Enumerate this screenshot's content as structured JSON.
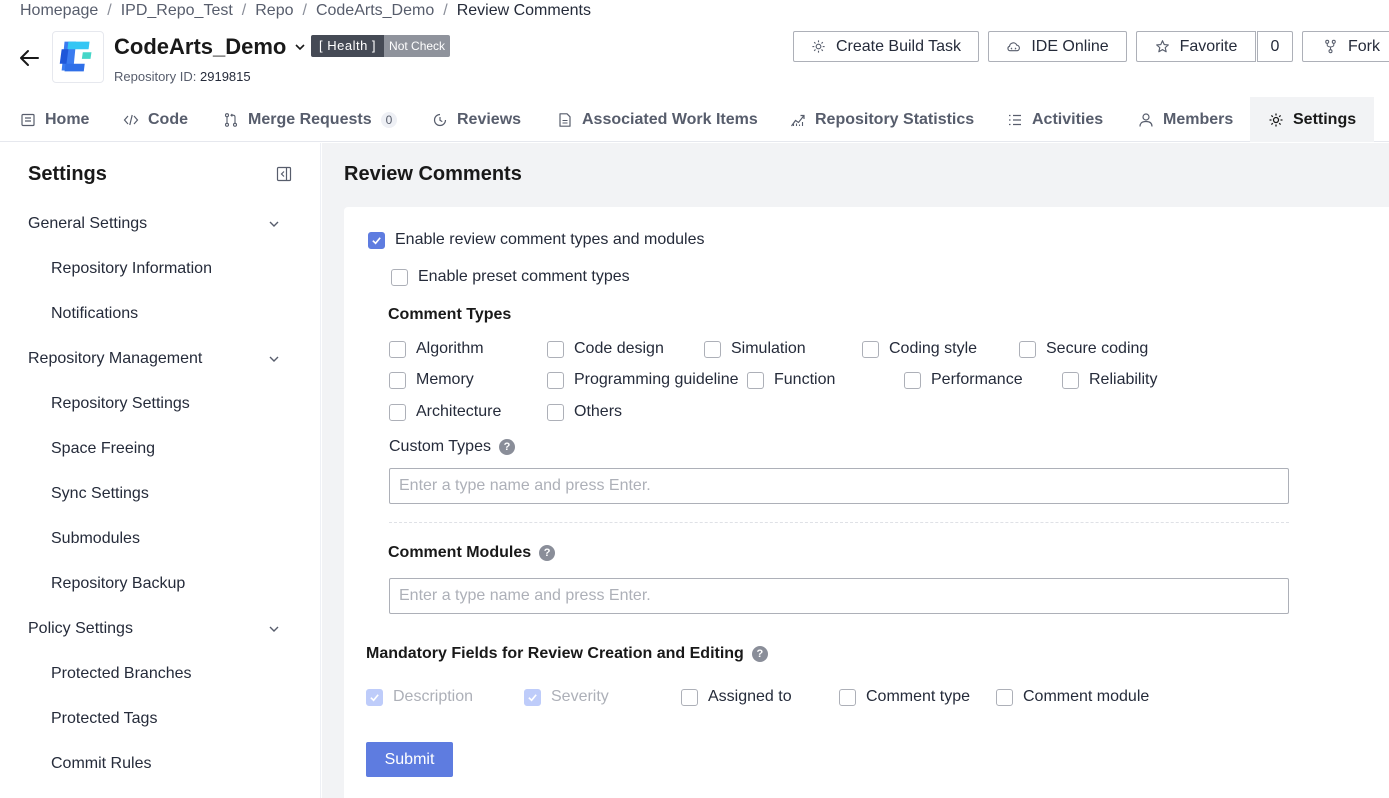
{
  "breadcrumb": [
    "Homepage",
    "IPD_Repo_Test",
    "Repo",
    "CodeArts_Demo",
    "Review Comments"
  ],
  "repo": {
    "name": "CodeArts_Demo",
    "health_label": "[ Health ]",
    "health_status": "Not Check",
    "id_label": "Repository ID:",
    "id_value": "2919815"
  },
  "header_buttons": {
    "create_build_task": "Create Build Task",
    "ide_online": "IDE Online",
    "favorite": "Favorite",
    "favorite_count": "0",
    "fork": "Fork"
  },
  "tabs": {
    "home": "Home",
    "code": "Code",
    "merge_requests": "Merge Requests",
    "merge_requests_count": "0",
    "reviews": "Reviews",
    "associated_work_items": "Associated Work Items",
    "repository_statistics": "Repository Statistics",
    "activities": "Activities",
    "members": "Members",
    "settings": "Settings"
  },
  "sidebar": {
    "title": "Settings",
    "groups": {
      "general": "General Settings",
      "repo_mgmt": "Repository Management",
      "policy": "Policy Settings"
    },
    "items": {
      "repository_information": "Repository Information",
      "notifications": "Notifications",
      "repository_settings": "Repository Settings",
      "space_freeing": "Space Freeing",
      "sync_settings": "Sync Settings",
      "submodules": "Submodules",
      "repository_backup": "Repository Backup",
      "protected_branches": "Protected Branches",
      "protected_tags": "Protected Tags",
      "commit_rules": "Commit Rules"
    }
  },
  "main": {
    "title": "Review Comments",
    "enable_types_modules": "Enable review comment types and modules",
    "enable_preset": "Enable preset comment types",
    "comment_types_label": "Comment Types",
    "comment_types": {
      "algorithm": "Algorithm",
      "code_design": "Code design",
      "simulation": "Simulation",
      "coding_style": "Coding style",
      "secure_coding": "Secure coding",
      "memory": "Memory",
      "programming_guideline": "Programming guideline",
      "function": "Function",
      "performance": "Performance",
      "reliability": "Reliability",
      "architecture": "Architecture",
      "others": "Others"
    },
    "custom_types_label": "Custom Types",
    "custom_types_placeholder": "Enter a type name and press Enter.",
    "comment_modules_label": "Comment Modules",
    "comment_modules_placeholder": "Enter a type name and press Enter.",
    "mandatory_label": "Mandatory Fields for Review Creation and Editing",
    "mandatory_fields": {
      "description": "Description",
      "severity": "Severity",
      "assigned_to": "Assigned to",
      "comment_type": "Comment type",
      "comment_module": "Comment module"
    },
    "submit": "Submit"
  },
  "colors": {
    "accent": "#5e7ce0",
    "disabled_check": "#beccfa",
    "main_bg": "#f2f3f5"
  }
}
